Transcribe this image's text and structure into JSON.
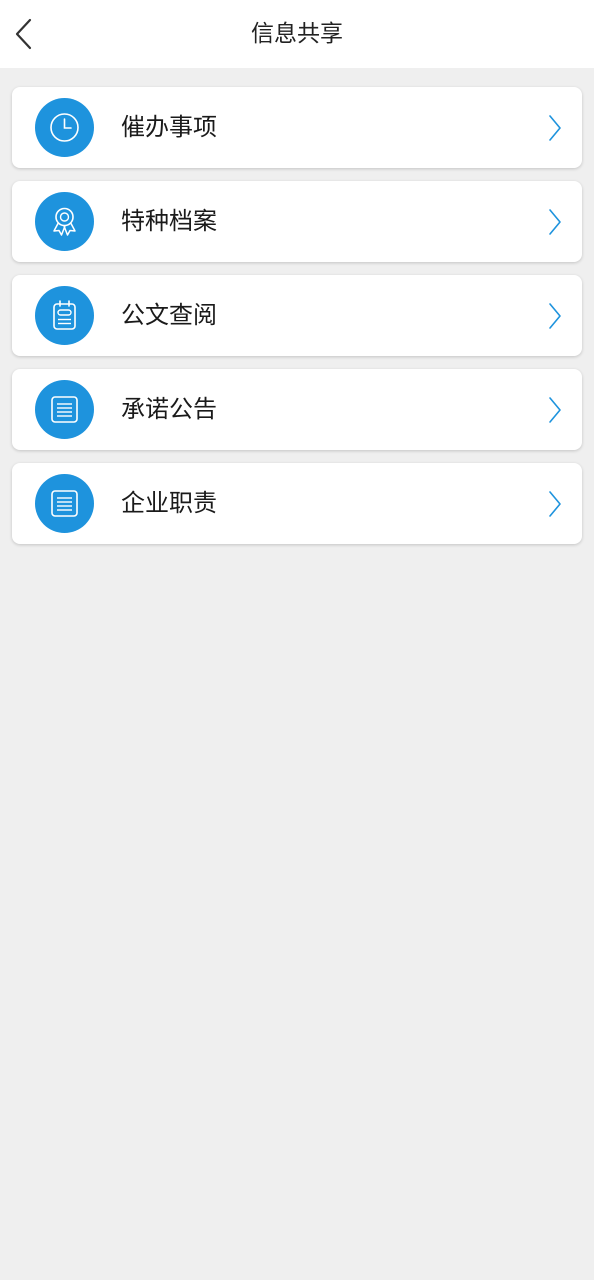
{
  "header": {
    "title": "信息共享",
    "back_icon": "chevron-left-icon"
  },
  "colors": {
    "accent": "#1e93dd",
    "background": "#efefef",
    "card": "#ffffff"
  },
  "menu": {
    "items": [
      {
        "label": "催办事项",
        "icon": "clock-icon"
      },
      {
        "label": "特种档案",
        "icon": "award-ribbon-icon"
      },
      {
        "label": "公文查阅",
        "icon": "notebook-icon"
      },
      {
        "label": "承诺公告",
        "icon": "document-list-icon"
      },
      {
        "label": "企业职责",
        "icon": "document-list-icon"
      }
    ]
  }
}
